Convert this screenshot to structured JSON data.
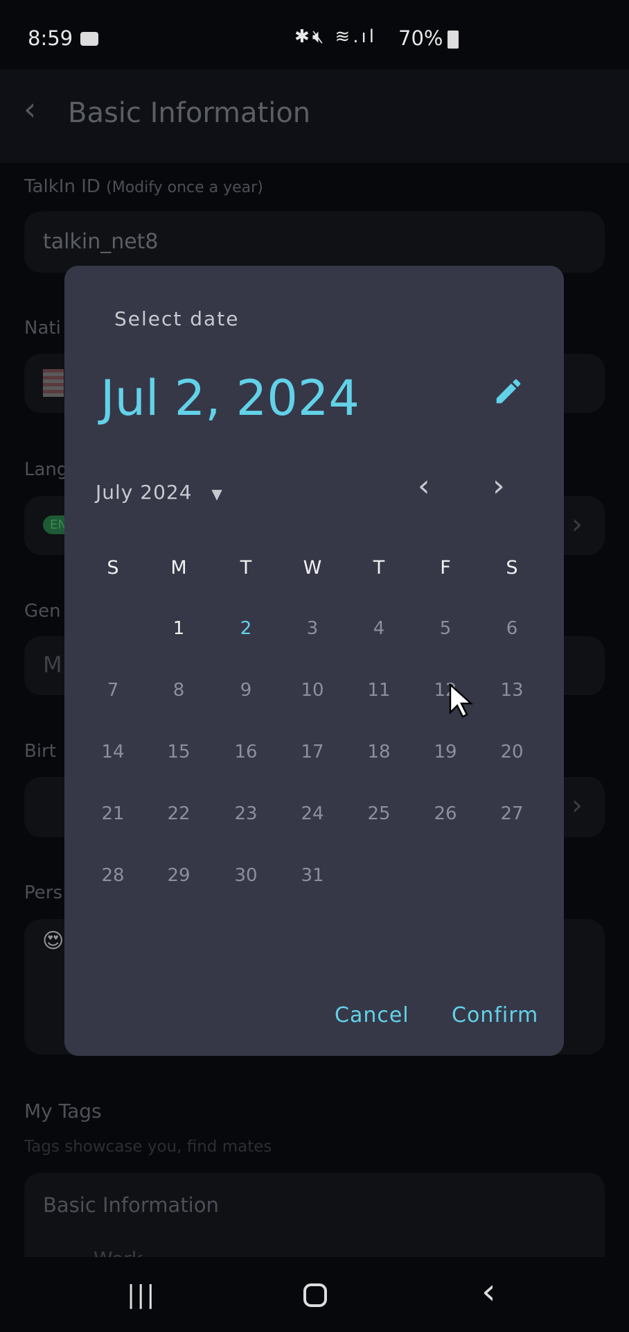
{
  "status_bar": {
    "time": "8:59",
    "battery": "70%",
    "icons": [
      "video-record-icon",
      "bluetooth-icon",
      "mute-icon",
      "wifi-icon",
      "signal-icon",
      "battery-icon"
    ]
  },
  "header": {
    "title": "Basic Information",
    "back_icon": "chevron-left-icon"
  },
  "form": {
    "talkin_id_label": "TalkIn ID",
    "talkin_id_note": "(Modify once a year)",
    "talkin_id_value": "talkin_net8",
    "nationality_label": "Nati",
    "language_label": "Lang",
    "language_badge": "EN",
    "gender_label": "Gen",
    "gender_value": "M",
    "birthday_label": "Birt",
    "personal_label": "Pers",
    "personal_emoji": "😍",
    "tags_title": "My Tags",
    "tags_subtitle": "Tags showcase you, find mates",
    "tags_card_title": "Basic Information",
    "tags_row_label": "Work"
  },
  "dialog": {
    "title": "Select date",
    "selected_date": "Jul 2, 2024",
    "month_label": "July 2024",
    "weekdays": [
      "S",
      "M",
      "T",
      "W",
      "T",
      "F",
      "S"
    ],
    "weeks": [
      [
        "",
        "1",
        "2",
        "3",
        "4",
        "5",
        "6"
      ],
      [
        "7",
        "8",
        "9",
        "10",
        "11",
        "12",
        "13"
      ],
      [
        "14",
        "15",
        "16",
        "17",
        "18",
        "19",
        "20"
      ],
      [
        "21",
        "22",
        "23",
        "24",
        "25",
        "26",
        "27"
      ],
      [
        "28",
        "29",
        "30",
        "31",
        "",
        "",
        ""
      ]
    ],
    "selected_day": "2",
    "today": "1",
    "cancel": "Cancel",
    "confirm": "Confirm",
    "accent": "#62d2e8"
  }
}
